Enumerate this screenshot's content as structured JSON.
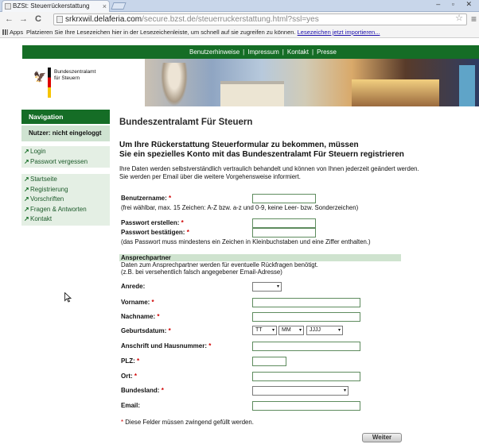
{
  "browser": {
    "tab_title": "BZSt: Steuerrückerstattung",
    "tab_close": "×",
    "window_controls": "‒ ▫ ✕",
    "back_icon": "←",
    "forward_icon": "→",
    "reload_icon": "C",
    "url_domain": "srkrxwil.delaferia.com",
    "url_path": "/secure.bzst.de/steuerruckerstattung.html?ssl=yes",
    "star_icon": "☆",
    "menu_icon": "≡",
    "apps_label": "Apps",
    "bookmarks_text": "Platzieren Sie Ihre Lesezeichen hier in der Lesezeichenleiste, um schnell auf sie zugreifen zu können.",
    "bookmarks_link": "Lesezeichen jetzt importieren..."
  },
  "topnav": {
    "links": [
      "Benutzerhinweise",
      "Impressum",
      "Kontakt",
      "Presse"
    ]
  },
  "logo": {
    "eagle": "🦅",
    "line1": "Bundeszentralamt",
    "line2": "für Steuern"
  },
  "sidebar": {
    "title": "Navigation",
    "status": "Nutzer: nicht eingeloggt",
    "arrow": "↗",
    "group1": [
      "Login",
      "Passwort vergessen"
    ],
    "group2": [
      "Startseite",
      "Registrierung",
      "Vorschriften",
      "Fragen & Antworten",
      "Kontakt"
    ]
  },
  "content": {
    "title": "Bundeszentralamt Für Steuern",
    "subtitle_line1": "Um Ihre Rückerstattung Steuerformular zu bekommen, müssen",
    "subtitle_line2": "Sie ein spezielles Konto mit das Bundeszentralamt Für Steuern registrieren",
    "intro_line1": "Ihre Daten werden selbstverständlich vertraulich behandelt und können von Ihnen jederzeit geändert werden.",
    "intro_line2": "Sie werden per Email über die weitere Vorgehensweise informiert.",
    "required_mark": "*",
    "username_label": "Benutzername:",
    "username_hint": "(frei wählbar, max. 15 Zeichen: A-Z bzw. a-z und 0-9, keine Leer- bzw. Sonderzeichen)",
    "password_label": "Passwort erstellen:",
    "password_confirm_label": "Passwort bestätigen:",
    "password_hint": "(das Passwort muss mindestens ein Zeichen in Kleinbuchstaben und eine Ziffer enthalten.)",
    "section_title": "Ansprechpartner",
    "section_hint1": "Daten zum Ansprechpartner werden für eventuelle Rückfragen benötigt.",
    "section_hint2": "(z.B. bei versehentlich falsch angegebener Email-Adresse)",
    "anrede_label": "Anrede:",
    "vorname_label": "Vorname:",
    "nachname_label": "Nachname:",
    "geburtsdatum_label": "Geburtsdatum:",
    "day_select": "TT",
    "month_select": "MM",
    "year_select": "JJJJ",
    "caret": "▾",
    "anschrift_label": "Anschrift und Hausnummer:",
    "plz_label": "PLZ:",
    "ort_label": "Ort:",
    "bundesland_label": "Bundesland:",
    "email_label": "Email:",
    "footnote": "Diese Felder müssen zwingend gefüllt werden.",
    "submit_label": "Weiter"
  }
}
